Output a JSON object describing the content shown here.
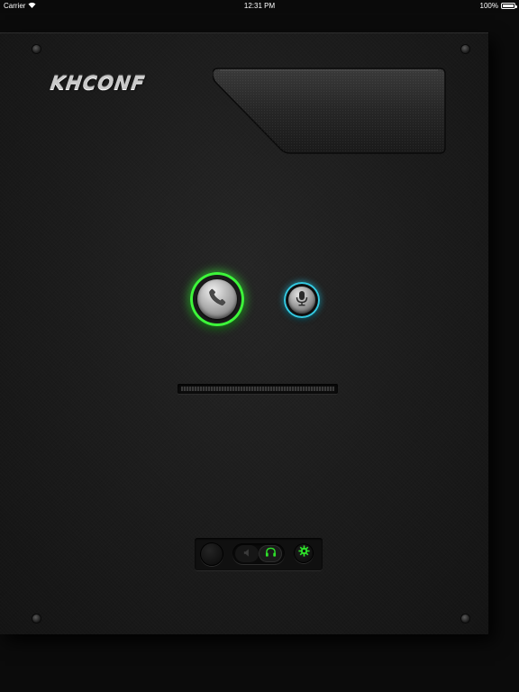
{
  "status_bar": {
    "carrier": "Carrier",
    "time": "12:31 PM",
    "battery_percent": "100%",
    "battery_level": 1.0
  },
  "app": {
    "logo_text": "KHCONF"
  },
  "controls": {
    "call_button_icon": "phone-icon",
    "call_accent": "#3df53a",
    "mic_button_icon": "microphone-icon",
    "mic_accent": "#34c8e0",
    "level_meter_value": 0,
    "audio_route_options": [
      "speaker-icon",
      "headset-icon"
    ],
    "audio_route_selected": "headset-icon",
    "settings_icon": "gear-icon",
    "control_accent": "#2ee02a"
  }
}
